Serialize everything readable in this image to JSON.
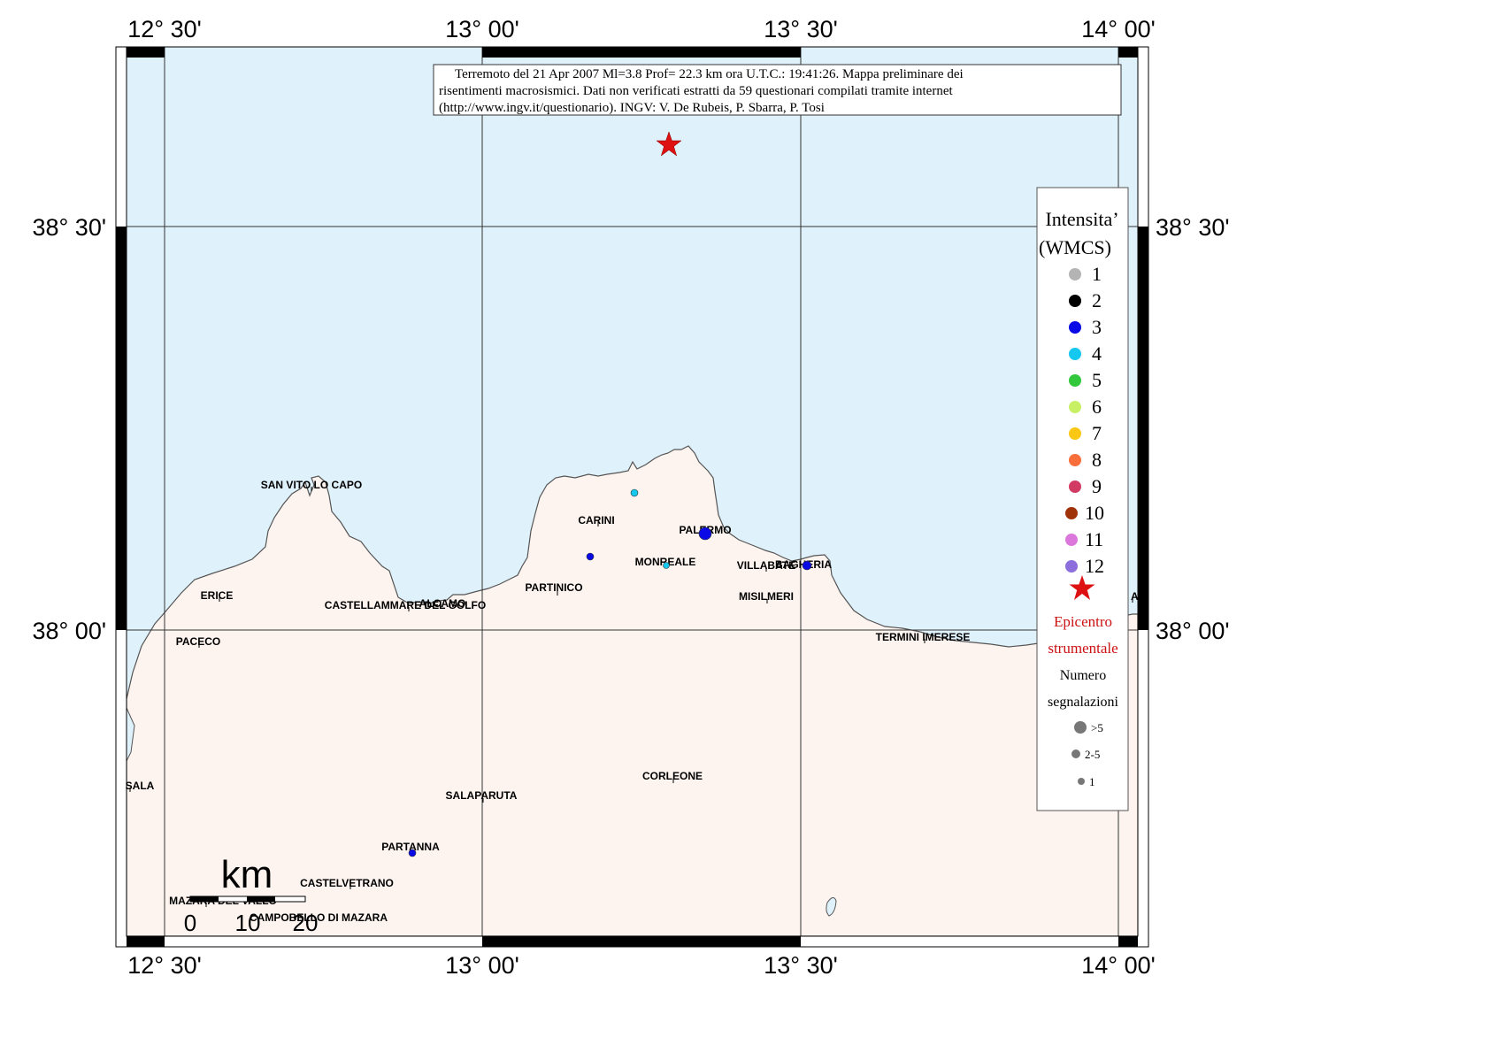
{
  "map": {
    "lon_labels": [
      "12° 30'",
      "13° 00'",
      "13° 30'",
      "14° 00'"
    ],
    "lat_labels": [
      "38° 30'",
      "38° 00'"
    ],
    "colors": {
      "sea": "#dff1fb",
      "land": "#fdf4f0",
      "coast": "#555555",
      "frame": "#000000"
    }
  },
  "info_box": {
    "line1": "Terremoto del 21 Apr 2007 Ml=3.8 Prof= 22.3 km ora U.T.C.: 19:41:26.  Mappa preliminare dei",
    "line2": "risentimenti macrosismici.    Dati non verificati estratti da 59 questionari compilati tramite internet",
    "line3": "(http://www.ingv.it/questionario).   INGV: V.  De Rubeis, P.  Sbarra, P.  Tosi"
  },
  "towns": [
    {
      "name": "SAN VITO LO CAPO"
    },
    {
      "name": "CARINI"
    },
    {
      "name": "PALERMO"
    },
    {
      "name": "MONREALE"
    },
    {
      "name": "VILLABATE"
    },
    {
      "name": "BAGHERIA"
    },
    {
      "name": "ERICE"
    },
    {
      "name": "ALCAMO"
    },
    {
      "name": "CASTELLAMMARE DEL GOLFO"
    },
    {
      "name": "PARTINICO"
    },
    {
      "name": "MISILMERI"
    },
    {
      "name": "PACECO"
    },
    {
      "name": "TERMINI IMERESE"
    },
    {
      "name": "SALA"
    },
    {
      "name": "SALAPARUTA"
    },
    {
      "name": "CORLEONE"
    },
    {
      "name": "PARTANNA"
    },
    {
      "name": "CASTELVETRANO"
    },
    {
      "name": "MAZARA DEL VALLO"
    },
    {
      "name": "CAMPOBELLO DI MAZARA"
    },
    {
      "name": "AL"
    }
  ],
  "observations": [
    {
      "intensity": 4,
      "reports": "1"
    },
    {
      "intensity": 3,
      "reports": ">5"
    },
    {
      "intensity": 3,
      "reports": "1"
    },
    {
      "intensity": 4,
      "reports": "1"
    },
    {
      "intensity": 3,
      "reports": "2-5"
    },
    {
      "intensity": 3,
      "reports": "1"
    }
  ],
  "legend": {
    "title1": "Intensita’",
    "title2": "(WMCS)",
    "levels": [
      {
        "label": "1",
        "color": "#b4b4b4"
      },
      {
        "label": "2",
        "color": "#000000"
      },
      {
        "label": "3",
        "color": "#0a0ae6"
      },
      {
        "label": "4",
        "color": "#14c8f0"
      },
      {
        "label": "5",
        "color": "#32c83c"
      },
      {
        "label": "6",
        "color": "#c8f064"
      },
      {
        "label": "7",
        "color": "#fac814"
      },
      {
        "label": "8",
        "color": "#fa6e3c"
      },
      {
        "label": "9",
        "color": "#d23c64"
      },
      {
        "label": "10",
        "color": "#a0320a"
      },
      {
        "label": "11",
        "color": "#dc78dc"
      },
      {
        "label": "12",
        "color": "#8c6edc"
      }
    ],
    "epicenter1": "Epicentro",
    "epicenter2": "strumentale",
    "count_title1": "Numero",
    "count_title2": "segnalazioni",
    "sizes": [
      ">5",
      "2-5",
      "1"
    ]
  },
  "scale_bar": {
    "unit": "km",
    "ticks": [
      "0",
      "10",
      "20"
    ]
  }
}
